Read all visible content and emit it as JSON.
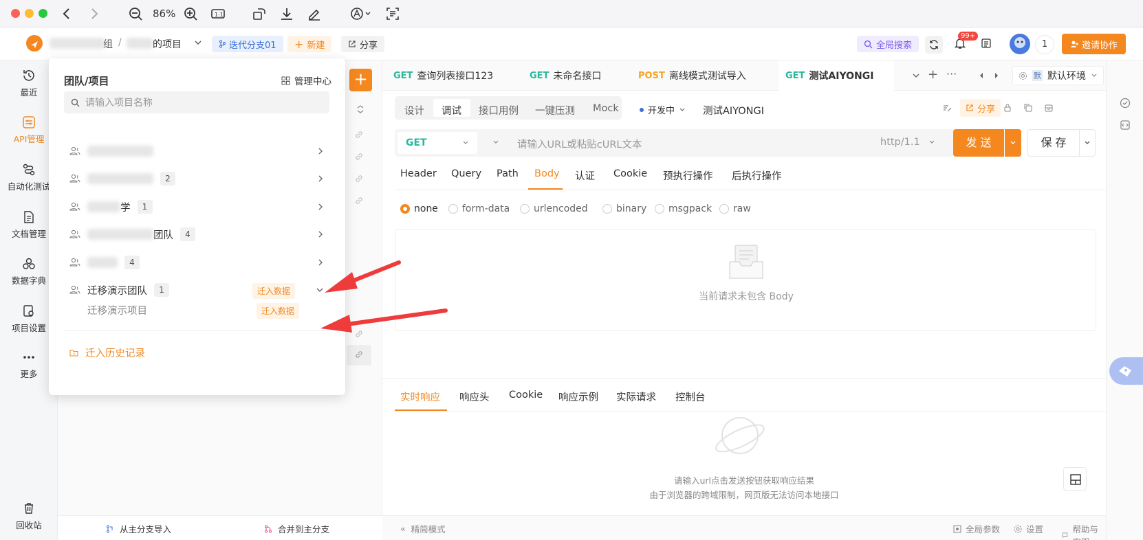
{
  "toolbar": {
    "zoom": "86%"
  },
  "header": {
    "breadcrumb_team": "组",
    "breadcrumb_sep": "/",
    "breadcrumb_project": "的项目",
    "branch": "迭代分支01",
    "new": "新建",
    "share": "分享",
    "global_search": "全局搜索",
    "notif_count": "99+",
    "user_count": "1",
    "invite": "邀请协作"
  },
  "sidebar": {
    "items": [
      {
        "label": "最近"
      },
      {
        "label": "API管理"
      },
      {
        "label": "自动化测试"
      },
      {
        "label": "文档管理"
      },
      {
        "label": "数据字典"
      },
      {
        "label": "项目设置"
      },
      {
        "label": "更多"
      },
      {
        "label": "回收站"
      }
    ]
  },
  "midpanel": {
    "import_from_main": "从主分支导入",
    "merge_to_main": "合并到主分支"
  },
  "dropdown": {
    "title": "团队/项目",
    "manage": "管理中心",
    "search_placeholder": "请输入项目名称",
    "rows": [
      {
        "suffix": "",
        "count": ""
      },
      {
        "suffix": "",
        "count": "2"
      },
      {
        "suffix": "学",
        "count": "1"
      },
      {
        "suffix": "团队",
        "count": "4"
      },
      {
        "suffix": "",
        "count": "4"
      }
    ],
    "migrate_team": "迁移演示团队",
    "migrate_team_count": "1",
    "migrate_btn": "迁入数据",
    "migrate_project": "迁移演示项目",
    "migrate_btn2": "迁入数据",
    "history": "迁入历史记录"
  },
  "tabs": [
    {
      "method": "GET",
      "name": "查询列表接口123"
    },
    {
      "method": "GET",
      "name": "未命名接口"
    },
    {
      "method": "POST",
      "name": "离线模式测试导入"
    },
    {
      "method": "GET",
      "name": "测试AIYONGI"
    }
  ],
  "env": {
    "badge": "默",
    "name": "默认环境"
  },
  "subtabs": [
    "设计",
    "调试",
    "接口用例",
    "一键压测",
    "Mock"
  ],
  "status": "开发中",
  "api_name": "测试AIYONGI",
  "share_btn": "分享",
  "request": {
    "method": "GET",
    "url_placeholder": "请输入URL或粘贴cURL文本",
    "protocol": "http/1.1",
    "send": "发 送",
    "save": "保 存"
  },
  "paramtabs": [
    "Header",
    "Query",
    "Path",
    "Body",
    "认证",
    "Cookie",
    "预执行操作",
    "后执行操作"
  ],
  "body_types": [
    "none",
    "form-data",
    "urlencoded",
    "binary",
    "msgpack",
    "raw"
  ],
  "empty_body": "当前请求未包含 Body",
  "resptabs": [
    "实时响应",
    "响应头",
    "Cookie",
    "响应示例",
    "实际请求",
    "控制台"
  ],
  "resp_hint1": "请输入url点击发送按钮获取响应结果",
  "resp_hint2": "由于浏览器的跨域限制，网页版无法访问本地接口",
  "bottom": {
    "compact": "精简模式",
    "global_params": "全局参数",
    "settings": "设置",
    "help": "帮助与客服"
  }
}
